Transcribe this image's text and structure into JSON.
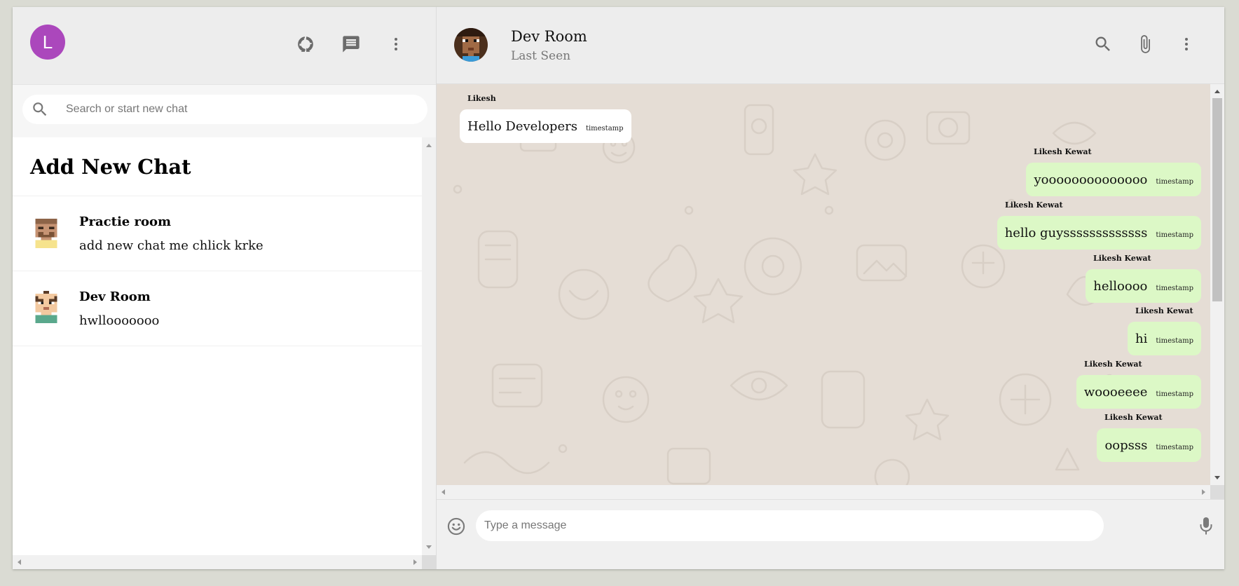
{
  "sidebar": {
    "user_initial": "L",
    "search_placeholder": "Search or start new chat",
    "add_new_chat": "Add New Chat",
    "chats": [
      {
        "name": "Practie room",
        "last_message": "add new chat me chlick krke"
      },
      {
        "name": "Dev Room",
        "last_message": "hwllooooooo"
      }
    ],
    "icons": [
      "status-icon",
      "new-chat-icon",
      "more-vert-icon",
      "search-icon"
    ]
  },
  "chat": {
    "room_name": "Dev Room",
    "room_status": "Last Seen",
    "icons": [
      "search-icon",
      "attach-icon",
      "more-vert-icon"
    ],
    "messages": [
      {
        "sender": "Likesh",
        "text": "Hello Developers",
        "timestamp": "timestamp",
        "direction": "incoming"
      },
      {
        "sender": "Likesh Kewat",
        "text": "yoooooooooooooo",
        "timestamp": "timestamp",
        "direction": "outgoing"
      },
      {
        "sender": "Likesh Kewat",
        "text": "hello guysssssssssssss",
        "timestamp": "timestamp",
        "direction": "outgoing"
      },
      {
        "sender": "Likesh Kewat",
        "text": "helloooo",
        "timestamp": "timestamp",
        "direction": "outgoing"
      },
      {
        "sender": "Likesh Kewat",
        "text": "hi",
        "timestamp": "timestamp",
        "direction": "outgoing"
      },
      {
        "sender": "Likesh Kewat",
        "text": "woooeeee",
        "timestamp": "timestamp",
        "direction": "outgoing"
      },
      {
        "sender": "Likesh Kewat",
        "text": "oopsss",
        "timestamp": "timestamp",
        "direction": "outgoing"
      }
    ],
    "input_placeholder": "Type a message"
  },
  "colors": {
    "avatar": "#ab47bc",
    "outgoing_bubble": "#dcf8c6",
    "incoming_bubble": "#ffffff",
    "chat_background": "#e5ddd5",
    "header": "#ededed"
  }
}
